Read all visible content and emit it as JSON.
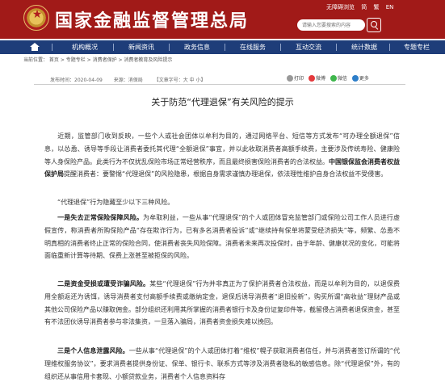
{
  "header": {
    "site_title": "国家金融监督管理总局",
    "utility_links": [
      "无障碍浏览",
      "简",
      "繁",
      "EN"
    ],
    "search_placeholder": "请输入您要搜索的内容"
  },
  "nav": {
    "items": [
      "机构概况",
      "新闻资讯",
      "政务信息",
      "在线服务",
      "互动交流",
      "统计数据",
      "专题专栏"
    ]
  },
  "breadcrumb": "当前位置： 首页 > 专题专栏 > 消费者保护 > 消费者教育及风险提示",
  "meta": {
    "date": "发布时间：2020-04-09",
    "source": "来源：消保局",
    "views": "【文章字号：",
    "font_size_label": "大 中 小】"
  },
  "share": {
    "print_label": "打印",
    "items": [
      {
        "label": "微博",
        "color": "#e4393c",
        "icon": "weibo-icon"
      },
      {
        "label": "微信",
        "color": "#3fb64c",
        "icon": "wechat-icon"
      },
      {
        "label": "更多",
        "color": "#2d7ec9",
        "icon": "more-icon"
      }
    ]
  },
  "article": {
    "title": "关于防范“代理退保”有关风险的提示",
    "p1_a": "近期，监管部门收到反映，一些个人或社会团体以牟利为目的，通过网络平台、短信等方式发布“可办理全额退保”信息，以怂恿、诱导等手段让消费者委托其代理“全额退保”事宜，并以此收取消费者高额手续费，主要涉及传统寿险、健康险等人身保险产品。此类行为不仅扰乱保险市场正常经营秩序，而且最终损害保险消费者的合法权益。",
    "p1_b": "中国银保监会消费者权益保护局",
    "p1_c": "提醒消费者：要警惕“代理退保”的风险隐患，根据自身需求谨慎办理退保，依法理性维护自身合法权益不受侵害。",
    "p2": "“代理退保”行为隐藏至少以下三种风险。",
    "p3_a": "一是失去正常保险保障风险。",
    "p3_b": "为牟取利益，一些从事“代理退保”的个人或团体冒充监管部门或保险公司工作人员进行虚假宣传，称消费者所购保险产品“存在欺诈行为，已有多名消费者投诉”或“继续持有保单将蒙受经济损失”等，频繁、怂恿不明真相的消费者终止正常的保险合同，使消费者丧失风险保障。消费者未来再次投保时，由于年龄、健康状况的变化，可能将面临重新计算等待期、保费上涨甚至被拒保的风险。",
    "p4_a": "二是资金受损或遭受诈骗风险。",
    "p4_b": "某些“代理退保”行为并非真正为了保护消费者合法权益，而是以牟利为目的，以退保费用全额返还为诱饵，诱导消费者支付高额手续费或缴纳定金，退保后诱导消费者“退旧投新”，购买所谓“高收益”理财产品或其他公司保险产品以赚取佣金。部分组织还利用其所掌握的消费者银行卡及身份证复印件等，截留侵占消费者退保资金，甚至有不法团伙诱导消费者参与非法集资，一旦落入骗局，消费者资金损失难以挽回。",
    "p5_a": "三是个人信息泄露风险。",
    "p5_b": "一些从事“代理退保”的个人或团体打着“维权”幌子获取消费者信任，并与消费者签订所谓的“代理维权服务协议”，要求消费者提供身份证、保单、银行卡、联系方式等涉及消费者隐私的敏感信息。除“代理退保”外，有的组织还从事信用卡套现、小额贷款业务，消费者个人信息资料存"
  }
}
